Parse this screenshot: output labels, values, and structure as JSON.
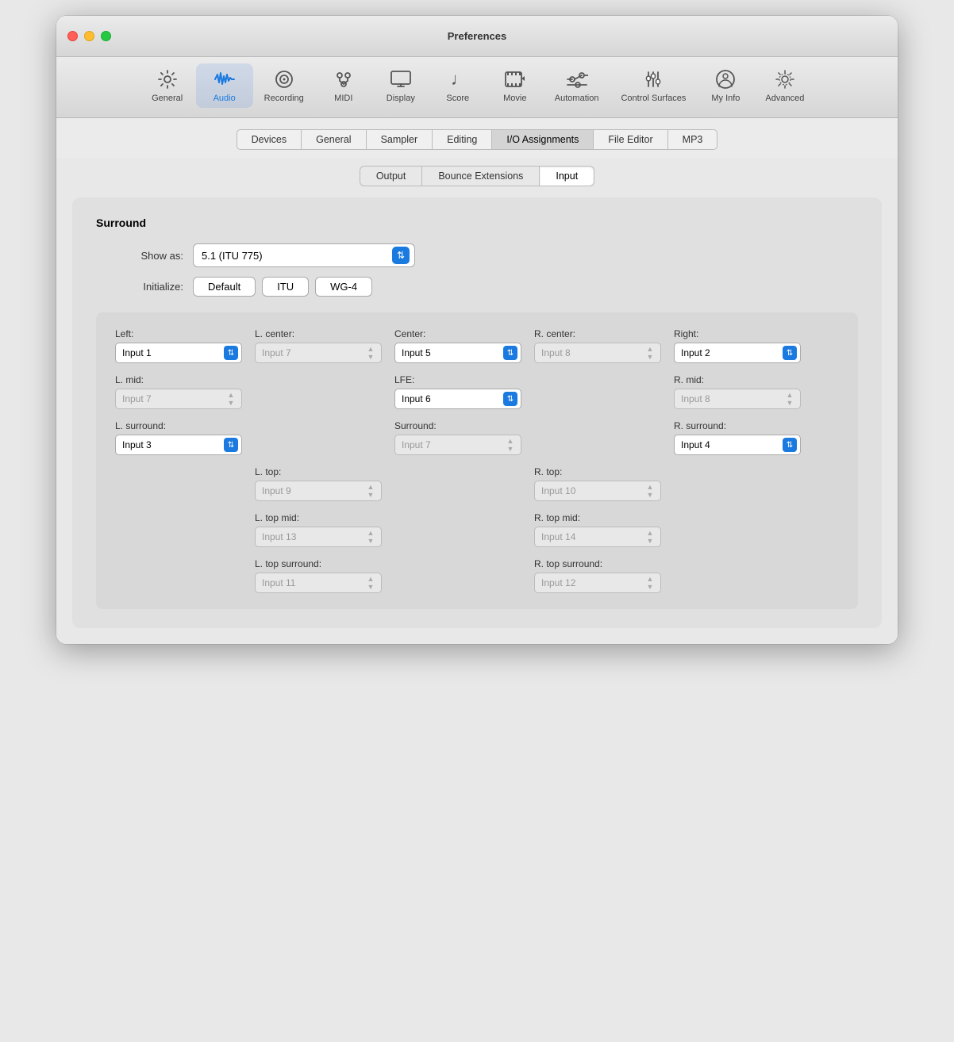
{
  "window": {
    "title": "Preferences"
  },
  "toolbar": {
    "items": [
      {
        "id": "general",
        "label": "General",
        "icon": "⚙️",
        "active": false
      },
      {
        "id": "audio",
        "label": "Audio",
        "icon": "audio",
        "active": true
      },
      {
        "id": "recording",
        "label": "Recording",
        "icon": "recording",
        "active": false
      },
      {
        "id": "midi",
        "label": "MIDI",
        "icon": "midi",
        "active": false
      },
      {
        "id": "display",
        "label": "Display",
        "icon": "display",
        "active": false
      },
      {
        "id": "score",
        "label": "Score",
        "icon": "score",
        "active": false
      },
      {
        "id": "movie",
        "label": "Movie",
        "icon": "movie",
        "active": false
      },
      {
        "id": "automation",
        "label": "Automation",
        "icon": "automation",
        "active": false
      },
      {
        "id": "control-surfaces",
        "label": "Control Surfaces",
        "icon": "control",
        "active": false
      },
      {
        "id": "my-info",
        "label": "My Info",
        "icon": "myinfo",
        "active": false
      },
      {
        "id": "advanced",
        "label": "Advanced",
        "icon": "advanced",
        "active": false
      }
    ]
  },
  "sub_tabs": [
    {
      "id": "devices",
      "label": "Devices",
      "active": false
    },
    {
      "id": "general",
      "label": "General",
      "active": false
    },
    {
      "id": "sampler",
      "label": "Sampler",
      "active": false
    },
    {
      "id": "editing",
      "label": "Editing",
      "active": false
    },
    {
      "id": "io-assignments",
      "label": "I/O Assignments",
      "active": true
    },
    {
      "id": "file-editor",
      "label": "File Editor",
      "active": false
    },
    {
      "id": "mp3",
      "label": "MP3",
      "active": false
    }
  ],
  "panel_tabs": [
    {
      "id": "output",
      "label": "Output",
      "active": false
    },
    {
      "id": "bounce-extensions",
      "label": "Bounce Extensions",
      "active": false
    },
    {
      "id": "input",
      "label": "Input",
      "active": true
    }
  ],
  "surround": {
    "title": "Surround",
    "show_as_label": "Show as:",
    "show_as_value": "5.1 (ITU 775)",
    "initialize_label": "Initialize:",
    "init_buttons": [
      "Default",
      "ITU",
      "WG-4"
    ],
    "fields": {
      "left": {
        "label": "Left:",
        "value": "Input 1",
        "active": true
      },
      "l_center": {
        "label": "L. center:",
        "value": "Input 7",
        "active": false
      },
      "center": {
        "label": "Center:",
        "value": "Input 5",
        "active": true
      },
      "r_center": {
        "label": "R. center:",
        "value": "Input 8",
        "active": false
      },
      "right": {
        "label": "Right:",
        "value": "Input 2",
        "active": true
      },
      "l_mid": {
        "label": "L. mid:",
        "value": "Input 7",
        "active": false
      },
      "lfe": {
        "label": "LFE:",
        "value": "Input 6",
        "active": true
      },
      "r_mid": {
        "label": "R. mid:",
        "value": "Input 8",
        "active": false
      },
      "l_surround": {
        "label": "L. surround:",
        "value": "Input 3",
        "active": true
      },
      "surround": {
        "label": "Surround:",
        "value": "Input 7",
        "active": false
      },
      "r_surround": {
        "label": "R. surround:",
        "value": "Input 4",
        "active": true
      },
      "l_top": {
        "label": "L. top:",
        "value": "Input 9",
        "active": false
      },
      "r_top": {
        "label": "R. top:",
        "value": "Input 10",
        "active": false
      },
      "l_top_mid": {
        "label": "L. top mid:",
        "value": "Input 13",
        "active": false
      },
      "r_top_mid": {
        "label": "R. top mid:",
        "value": "Input 14",
        "active": false
      },
      "l_top_surround": {
        "label": "L. top surround:",
        "value": "Input 11",
        "active": false
      },
      "r_top_surround": {
        "label": "R. top surround:",
        "value": "Input 12",
        "active": false
      }
    }
  }
}
